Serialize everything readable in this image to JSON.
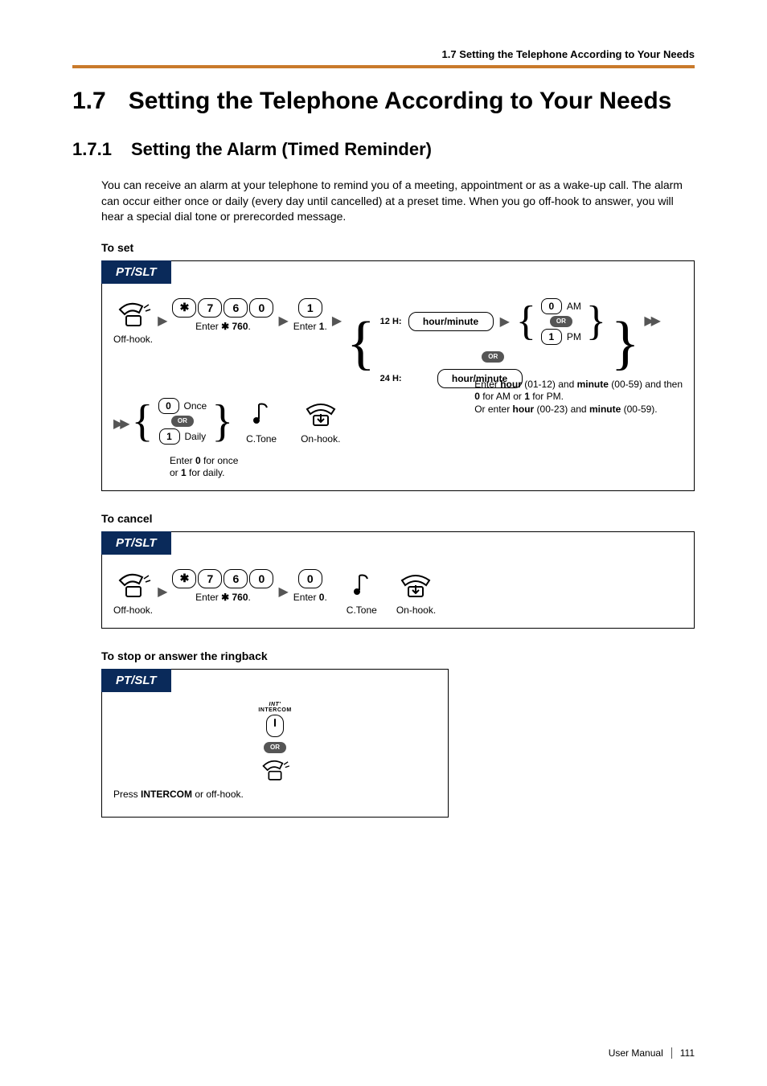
{
  "running_head": "1.7 Setting the Telephone According to Your Needs",
  "section": {
    "num": "1.7",
    "title": "Setting the Telephone According to Your Needs"
  },
  "subsection": {
    "num": "1.7.1",
    "title": "Setting the Alarm (Timed Reminder)"
  },
  "intro": "You can receive an alarm at your telephone to remind you of a meeting, appointment or as a wake-up call. The alarm can occur either once or daily (every day until cancelled) at a preset time. When you go off-hook to answer, you will hear a special dial tone or prerecorded message.",
  "proc_set": {
    "title": "To set",
    "badge": "PT/SLT"
  },
  "proc_cancel": {
    "title": "To cancel",
    "badge": "PT/SLT"
  },
  "proc_stop": {
    "title": "To stop or answer the ringback",
    "badge": "PT/SLT"
  },
  "labels": {
    "offhook": "Off-hook.",
    "onhook": "On-hook.",
    "enter760": "Enter    760.",
    "star": "✱",
    "seven": "7",
    "six": "6",
    "zero": "0",
    "one": "1",
    "enter1": "Enter 1.",
    "enter0": "Enter 0.",
    "ctone": "C.Tone",
    "or": "OR",
    "twelveH": "12 H:",
    "twentyfourH": "24 H:",
    "hourminute": "hour/minute",
    "am": "AM",
    "pm": "PM",
    "once": "Once",
    "daily": "Daily",
    "once_daily_caption": "Enter 0 for once or 1 for daily.",
    "intercom_caption_pre": "Press ",
    "intercom_word": "INTERCOM",
    "intercom_caption_post": " or off-hook.",
    "intercom_top1": "INT'",
    "intercom_top2": "INTERCOM"
  },
  "caption_time_1a": "Enter ",
  "caption_time_1b": "hour",
  "caption_time_1c": " (01-12) and ",
  "caption_time_1d": "minute",
  "caption_time_1e": " (00-59) and then ",
  "caption_time_2a": "0",
  "caption_time_2b": " for AM or ",
  "caption_time_2c": "1",
  "caption_time_2d": " for PM.",
  "caption_time_3a": "Or enter ",
  "caption_time_3b": "hour",
  "caption_time_3c": " (00-23) and ",
  "caption_time_3d": "minute",
  "caption_time_3e": " (00-59).",
  "footer": {
    "label": "User Manual",
    "page": "111"
  }
}
